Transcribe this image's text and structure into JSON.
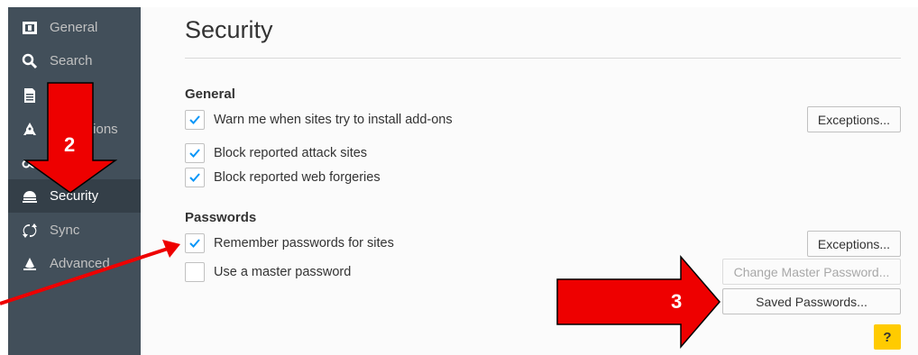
{
  "sidebar": {
    "items": [
      {
        "label": "General",
        "icon": "general-icon"
      },
      {
        "label": "Search",
        "icon": "search-icon"
      },
      {
        "label": "",
        "icon": "content-icon"
      },
      {
        "label": "tions",
        "icon": "applications-icon"
      },
      {
        "label": "",
        "icon": "privacy-icon"
      },
      {
        "label": "Security",
        "icon": "security-icon",
        "active": true
      },
      {
        "label": "Sync",
        "icon": "sync-icon"
      },
      {
        "label": "Advanced",
        "icon": "advanced-icon"
      }
    ]
  },
  "main": {
    "title": "Security",
    "general": {
      "heading": "General",
      "warn_addons": {
        "label": "Warn me when sites try to install add-ons",
        "checked": true
      },
      "exceptions_label": "Exceptions...",
      "block_attack": {
        "label": "Block reported attack sites",
        "checked": true
      },
      "block_forgeries": {
        "label": "Block reported web forgeries",
        "checked": true
      }
    },
    "passwords": {
      "heading": "Passwords",
      "remember": {
        "label": "Remember passwords for sites",
        "checked": true
      },
      "exceptions_label": "Exceptions...",
      "master": {
        "label": "Use a master password",
        "checked": false
      },
      "change_master_label": "Change Master Password...",
      "saved_passwords_label": "Saved Passwords..."
    },
    "help_label": "?"
  },
  "annotations": {
    "step2": "2",
    "step3": "3"
  },
  "colors": {
    "sidebar_bg": "#424f5a",
    "sidebar_active": "#343f48",
    "checkmark": "#0996f8",
    "help": "#ffcb00",
    "annotation_red": "#ee0000"
  }
}
